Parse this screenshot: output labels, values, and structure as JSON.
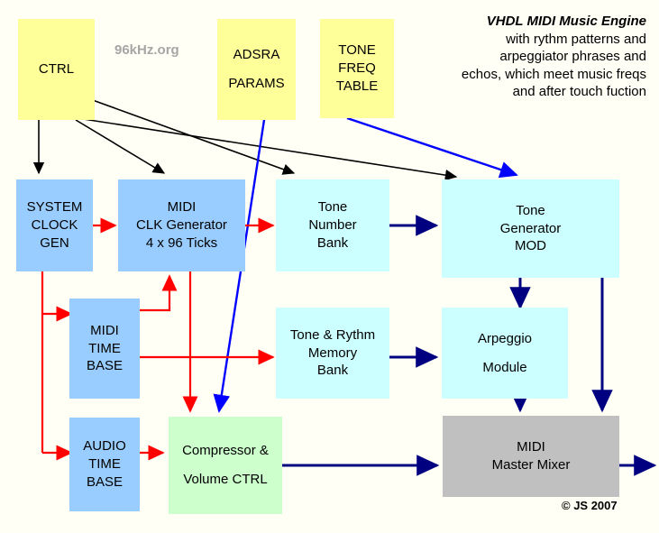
{
  "diagram": {
    "title_main": "VHDL MIDI Music Engine",
    "title_lines": [
      "with rythm patterns and",
      "arpeggiator phrases and",
      "echos, which meet music freqs",
      "and after touch fuction"
    ],
    "watermark": "96kHz.org",
    "copyright": "© JS 2007",
    "colors": {
      "param_block": "#ffff99",
      "clock_block": "#99ccff",
      "memory_block": "#ccffff",
      "audio_block": "#ccffcc",
      "mixer_block": "#c0c0c0",
      "wire_black": "#000000",
      "wire_red": "#ff0000",
      "wire_blue": "#0000ff",
      "wire_navy": "#000080",
      "background": "#fffff5"
    }
  },
  "blocks": {
    "ctrl": {
      "lines": [
        "CTRL"
      ]
    },
    "adsra_params": {
      "lines": [
        "ADSRA",
        "PARAMS"
      ]
    },
    "tone_freq_table": {
      "lines": [
        "TONE",
        "FREQ",
        "TABLE"
      ]
    },
    "system_clock_gen": {
      "lines": [
        "SYSTEM",
        "CLOCK",
        "GEN"
      ]
    },
    "midi_clk_generator": {
      "lines": [
        "MIDI",
        "CLK Generator",
        "4 x 96 Ticks"
      ]
    },
    "tone_number_bank": {
      "lines": [
        "Tone",
        "Number",
        "Bank"
      ]
    },
    "tone_generator_mod": {
      "lines": [
        "Tone",
        "Generator",
        "MOD"
      ]
    },
    "midi_time_base": {
      "lines": [
        "MIDI",
        "TIME",
        "BASE"
      ]
    },
    "tone_rythm_memory_bank": {
      "lines": [
        "Tone & Rythm",
        "Memory",
        "Bank"
      ]
    },
    "arpeggio_module": {
      "lines": [
        "Arpeggio",
        "Module"
      ]
    },
    "audio_time_base": {
      "lines": [
        "AUDIO",
        "TIME",
        "BASE"
      ]
    },
    "compressor_volume_ctrl": {
      "lines": [
        "Compressor &",
        "Volume CTRL"
      ]
    },
    "midi_master_mixer": {
      "lines": [
        "MIDI",
        "Master Mixer"
      ]
    }
  }
}
